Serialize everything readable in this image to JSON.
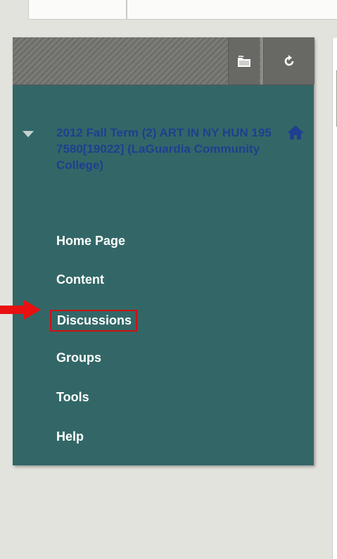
{
  "toolbar": {
    "folder_icon": "folder-icon",
    "refresh_icon": "refresh-icon"
  },
  "course": {
    "title": "2012 Fall Term (2) ART IN NY HUN 195 7580[19022] (LaGuardia Community College)",
    "home_icon": "home-icon",
    "collapse_icon": "triangle-down-icon"
  },
  "menu": {
    "items": [
      {
        "label": "Home Page"
      },
      {
        "label": "Content"
      },
      {
        "label": "Discussions"
      },
      {
        "label": "Groups"
      },
      {
        "label": "Tools"
      },
      {
        "label": "Help"
      }
    ]
  },
  "colors": {
    "panel_bg": "#336767",
    "title_color": "#1f3f8f",
    "highlight_box": "#cc1111",
    "arrow": "#e81010"
  }
}
